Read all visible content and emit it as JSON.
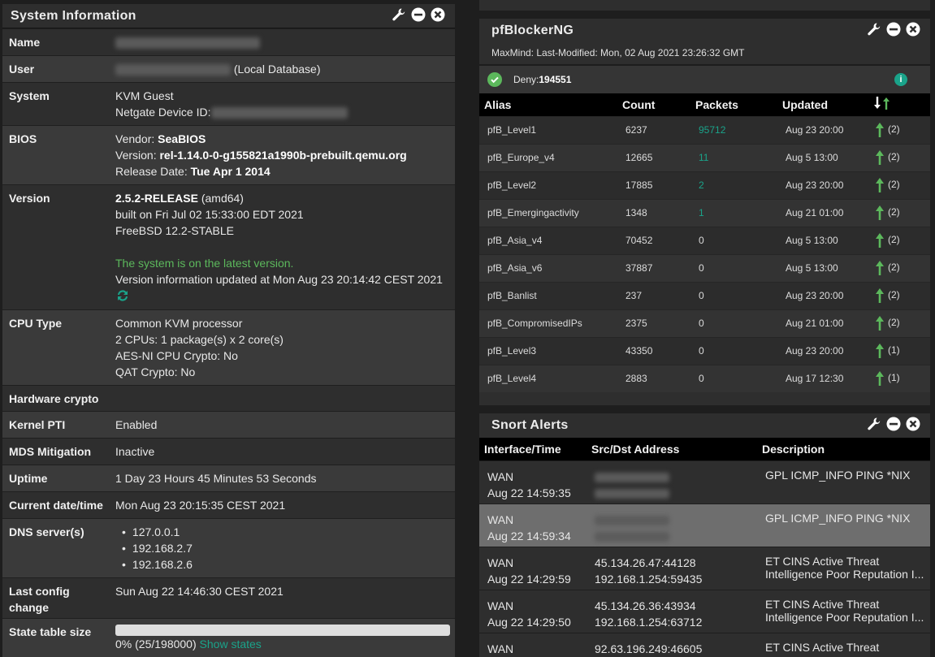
{
  "system_info": {
    "title": "System Information",
    "name_label": "Name",
    "user_label": "User",
    "user_suffix": "(Local Database)",
    "system_label": "System",
    "system_value": "KVM Guest",
    "netgate_label": "Netgate Device ID:",
    "bios_label": "BIOS",
    "bios_vendor_label": "Vendor: ",
    "bios_vendor": "SeaBIOS",
    "bios_version_label": "Version: ",
    "bios_version": "rel-1.14.0-0-g155821a1990b-prebuilt.qemu.org",
    "bios_date_label": "Release Date: ",
    "bios_date": "Tue Apr 1 2014",
    "version_label": "Version",
    "version_release": "2.5.2-RELEASE",
    "version_arch": " (amd64)",
    "version_built": "built on Fri Jul 02 15:33:00 EDT 2021",
    "version_freebsd": "FreeBSD 12.2-STABLE",
    "version_status": "The system is on the latest version.",
    "version_updated": "Version information updated at Mon Aug 23 20:14:42 CEST 2021",
    "cpu_label": "CPU Type",
    "cpu_lines": [
      "Common KVM processor",
      "2 CPUs: 1 package(s) x 2 core(s)",
      "AES-NI CPU Crypto: No",
      "QAT Crypto: No"
    ],
    "hwcrypto_label": "Hardware crypto",
    "kernel_label": "Kernel PTI",
    "kernel_value": "Enabled",
    "mds_label": "MDS Mitigation",
    "mds_value": "Inactive",
    "uptime_label": "Uptime",
    "uptime_value": "1 Day 23 Hours 45 Minutes 53 Seconds",
    "datetime_label": "Current date/time",
    "datetime_value": "Mon Aug 23 20:15:35 CEST 2021",
    "dns_label": "DNS server(s)",
    "dns_servers": [
      "127.0.0.1",
      "192.168.2.7",
      "192.168.2.6"
    ],
    "lastcfg_label": "Last config change",
    "lastcfg_value": "Sun Aug 22 14:46:30 CEST 2021",
    "state_label": "State table size",
    "state_value": "0% (25/198000)",
    "state_fraction": 0.000126,
    "show_states": "Show states"
  },
  "pfblocker": {
    "title": "pfBlockerNG",
    "maxmind": "MaxMind: Last-Modified: Mon, 02 Aug 2021 23:26:32 GMT",
    "deny_label": "Deny:",
    "deny_count": "194551",
    "headers": [
      "Alias",
      "Count",
      "Packets",
      "Updated"
    ],
    "rows": [
      {
        "alias": "pfB_Level1",
        "count": "6237",
        "packets": "95712",
        "updated": "Aug 23 20:00",
        "rules": "(2)"
      },
      {
        "alias": "pfB_Europe_v4",
        "count": "12665",
        "packets": "11",
        "updated": "Aug 5 13:00",
        "rules": "(2)"
      },
      {
        "alias": "pfB_Level2",
        "count": "17885",
        "packets": "2",
        "updated": "Aug 23 20:00",
        "rules": "(2)"
      },
      {
        "alias": "pfB_Emergingactivity",
        "count": "1348",
        "packets": "1",
        "updated": "Aug 21 01:00",
        "rules": "(2)"
      },
      {
        "alias": "pfB_Asia_v4",
        "count": "70452",
        "packets": "0",
        "updated": "Aug 5 13:00",
        "rules": "(2)"
      },
      {
        "alias": "pfB_Asia_v6",
        "count": "37887",
        "packets": "0",
        "updated": "Aug 5 13:00",
        "rules": "(2)"
      },
      {
        "alias": "pfB_Banlist",
        "count": "237",
        "packets": "0",
        "updated": "Aug 23 20:00",
        "rules": "(2)"
      },
      {
        "alias": "pfB_CompromisedIPs",
        "count": "2375",
        "packets": "0",
        "updated": "Aug 21 01:00",
        "rules": "(2)"
      },
      {
        "alias": "pfB_Level3",
        "count": "43350",
        "packets": "0",
        "updated": "Aug 23 20:00",
        "rules": "(1)"
      },
      {
        "alias": "pfB_Level4",
        "count": "2883",
        "packets": "0",
        "updated": "Aug 17 12:30",
        "rules": "(1)"
      }
    ]
  },
  "snort": {
    "title": "Snort Alerts",
    "headers": [
      "Interface/Time",
      "Src/Dst Address",
      "Description"
    ],
    "rows": [
      {
        "iface": "WAN",
        "time": "Aug 22 14:59:35",
        "src": "",
        "dst": "",
        "desc1": "GPL ICMP_INFO PING *NIX",
        "desc2": ""
      },
      {
        "iface": "WAN",
        "time": "Aug 22 14:59:34",
        "src": "",
        "dst": "",
        "desc1": "GPL ICMP_INFO PING *NIX",
        "desc2": ""
      },
      {
        "iface": "WAN",
        "time": "Aug 22 14:29:59",
        "src": "45.134.26.47:44128",
        "dst": "192.168.1.254:59435",
        "desc1": "ET CINS Active Threat",
        "desc2": "Intelligence Poor Reputation I..."
      },
      {
        "iface": "WAN",
        "time": "Aug 22 14:29:50",
        "src": "45.134.26.36:43934",
        "dst": "192.168.1.254:63712",
        "desc1": "ET CINS Active Threat",
        "desc2": "Intelligence Poor Reputation I..."
      },
      {
        "iface": "WAN",
        "time": "",
        "src": "92.63.196.249:46605",
        "dst": "",
        "desc1": "ET CINS Active Threat",
        "desc2": ""
      }
    ]
  },
  "colors": {
    "green": "#5cb85c",
    "teal": "#1aa38a",
    "header_black": "#000000",
    "panel": "#2e2e2e"
  }
}
